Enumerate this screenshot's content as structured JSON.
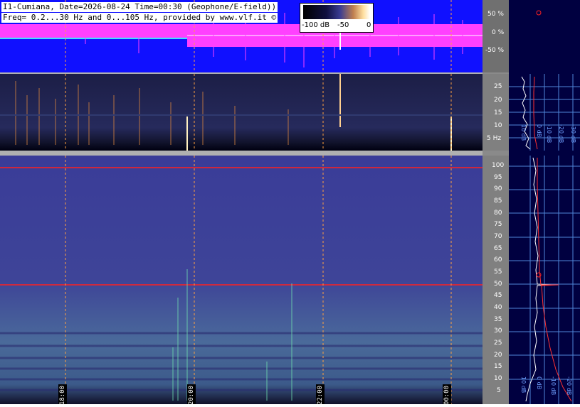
{
  "header": {
    "line1": "I1-Cumiana, Date=2026-08-24 Time=00:30 (Geophone/E-field))",
    "line2": "Freq= 0.2...30 Hz and 0...105 Hz, provided by www.vlf.it ©"
  },
  "legend": {
    "min_label": "-100 dB",
    "mid_label": "-50",
    "max_label": "0"
  },
  "waveform_axis": [
    "50 %",
    "0 %",
    "-50 %"
  ],
  "top_axis": [
    "25",
    "20",
    "15",
    "10",
    "5 Hz"
  ],
  "bottom_axis": [
    "100",
    "95",
    "90",
    "85",
    "80",
    "75",
    "70",
    "65",
    "60",
    "55",
    "50",
    "45",
    "40",
    "35",
    "30",
    "25",
    "20",
    "15",
    "10",
    "5"
  ],
  "time_labels": [
    "18:00",
    "20:00",
    "22:00",
    "00:00"
  ],
  "side_top_labels": [
    "10 dB",
    "0 dB",
    "-10 dB",
    "-20 dB",
    "-30 dB"
  ],
  "side_bottom_labels": [
    "10 dB",
    "0 dB",
    "-10 dB",
    "-20 dB"
  ],
  "colors": {
    "waveform_bg": "#1010ff",
    "waveform_signal": "#ff40ff",
    "marker_line": "#ff2020",
    "grid": "#4f86d8"
  }
}
